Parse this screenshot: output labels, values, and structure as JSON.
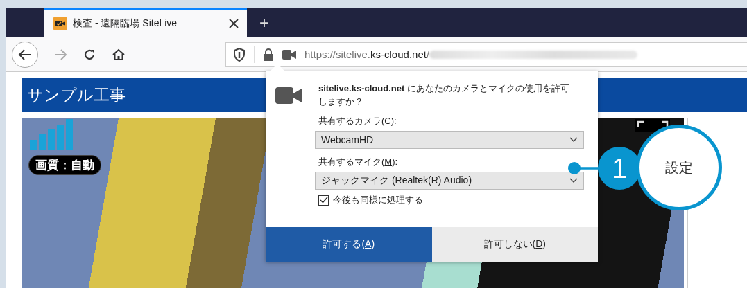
{
  "browser": {
    "tab": {
      "title": "検査 - 遠隔臨場 SiteLive",
      "selected": true
    },
    "new_tab": "+",
    "url": [
      {
        "text": "https://sitelive.",
        "highlighted": false
      },
      {
        "text": "ks-cloud.net",
        "highlighted": true
      },
      {
        "text": "/",
        "highlighted": false
      }
    ]
  },
  "page": {
    "title": "サンプル工事",
    "video": {
      "quality": "画質：自動"
    }
  },
  "permission_popup": {
    "message": "**sitelive.ks-cloud.net** にあなたのカメラとマイクの使用を許可しますか？",
    "fields": [
      {
        "label": {
          "before": "共有するカメラ(",
          "key": "C",
          "after": "):"
        },
        "value": "WebcamHD"
      },
      {
        "label": {
          "before": "共有するマイク(",
          "key": "M",
          "after": "):"
        },
        "value": "ジャックマイク (Realtek(R) Audio)"
      }
    ],
    "remember": {
      "label": "今後も同様に処理する",
      "checked": true
    },
    "buttons": [
      {
        "label": {
          "before": "許可する(",
          "key": "A",
          "after": ")"
        },
        "primary": true
      },
      {
        "label": {
          "before": "許可しない(",
          "key": "D",
          "after": ")"
        },
        "primary": false
      }
    ]
  },
  "callout": {
    "number": "1",
    "label": "設定"
  }
}
